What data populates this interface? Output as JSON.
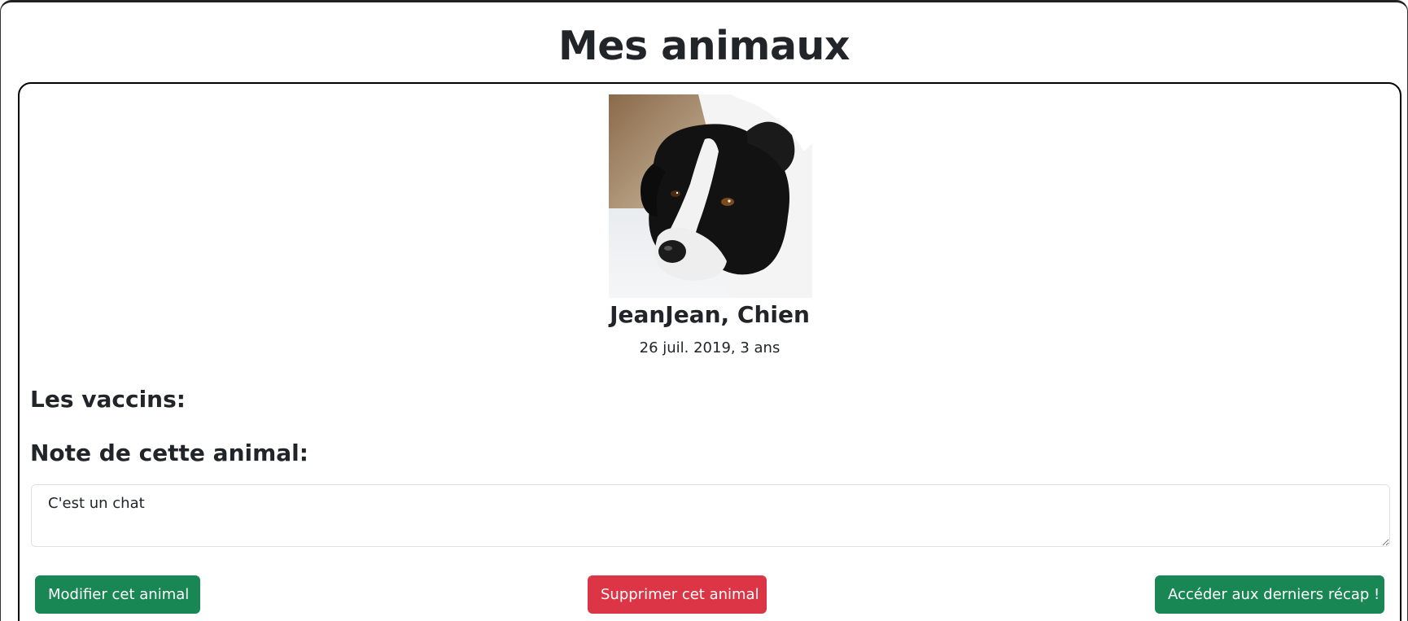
{
  "page": {
    "title": "Mes animaux"
  },
  "animal": {
    "name_type": "JeanJean, Chien",
    "birth_age": "26 juil. 2019, 3 ans",
    "photo_icon": "dog-photo"
  },
  "sections": {
    "vaccins_heading": "Les vaccins:",
    "note_heading": "Note de cette animal:"
  },
  "note": {
    "value": "C'est un chat"
  },
  "actions": {
    "edit_label": "Modifier cet animal",
    "delete_label": "Supprimer cet animal",
    "recap_label": "Accéder aux derniers récap !"
  },
  "colors": {
    "success": "#198754",
    "danger": "#dc3545"
  }
}
